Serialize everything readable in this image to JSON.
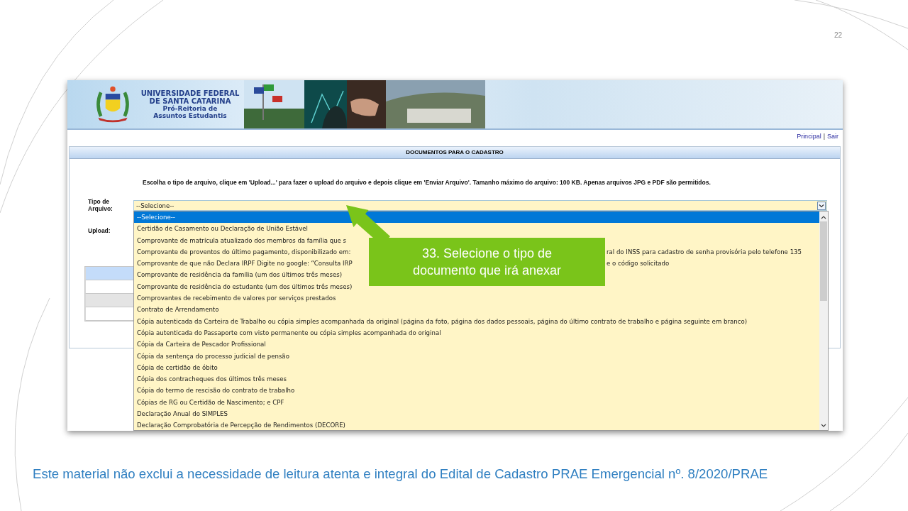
{
  "slide": {
    "page_number": "22",
    "footer": "Este material não exclui a necessidade de leitura atenta e integral do Edital de Cadastro PRAE Emergencial nº. 8/2020/PRAE"
  },
  "header": {
    "institution": [
      "UNIVERSIDADE FEDERAL",
      "DE SANTA CATARINA"
    ],
    "department": [
      "Pró-Reitoria de",
      "Assuntos Estudantis"
    ]
  },
  "nav_links": [
    {
      "label": "Principal"
    },
    {
      "label": "Sair"
    }
  ],
  "nav_separator": "|",
  "panel": {
    "title": "DOCUMENTOS PARA O CADASTRO",
    "instructions": "Escolha o tipo de arquivo, clique em 'Upload...' para fazer o upload do arquivo e depois clique em 'Enviar Arquivo'. Tamanho máximo do arquivo: 100 KB. Apenas arquivos JPG e PDF são permitidos.",
    "file_type_label": "Tipo de Arquivo:",
    "upload_label": "Upload:"
  },
  "file_type_select": {
    "value": "--Selecione--",
    "expanded": true,
    "options": [
      {
        "text": "--Selecione--",
        "selected": true
      },
      {
        "text": "Certidão de Casamento ou Declaração de União Estável",
        "selected": false
      },
      {
        "text": "Comprovante de matrícula atualizado dos membros da família que s",
        "selected": false
      },
      {
        "text": "Comprovante de proventos do último pagamento, disponibilizado em:",
        "text_after": "ral do INSS para cadastro de senha provisória pelo telefone 135",
        "selected": false
      },
      {
        "text": "Comprovante de que não Declara IRPF Digite no google: “Consulta IRP",
        "text_after": "e o código solicitado",
        "selected": false
      },
      {
        "text": "Comprovante de residência da família (um dos últimos três meses)",
        "selected": false
      },
      {
        "text": "Comprovante de residência do estudante (um dos últimos três meses)",
        "selected": false
      },
      {
        "text": "Comprovantes de recebimento de valores por serviços prestados",
        "selected": false
      },
      {
        "text": "Contrato de Arrendamento",
        "selected": false
      },
      {
        "text": "Cópia autenticada da Carteira de Trabalho ou cópia simples acompanhada da original (página da foto, página dos dados pessoais, página do último contrato de trabalho e página seguinte em branco)",
        "selected": false
      },
      {
        "text": "Cópia autenticada do Passaporte com visto permanente ou cópia simples acompanhada do original",
        "selected": false
      },
      {
        "text": "Cópia da Carteira de Pescador Profissional",
        "selected": false
      },
      {
        "text": "Cópia da sentença do processo judicial de pensão",
        "selected": false
      },
      {
        "text": "Cópia de certidão de óbito",
        "selected": false
      },
      {
        "text": "Cópia dos contracheques dos últimos três meses",
        "selected": false
      },
      {
        "text": "Cópia do termo de rescisão do contrato de trabalho",
        "selected": false
      },
      {
        "text": "Cópias de RG ou Certidão de Nascimento; e CPF",
        "selected": false
      },
      {
        "text": "Declaração Anual do SIMPLES",
        "selected": false
      },
      {
        "text": "Declaração Comprobatória de Percepção de Rendimentos (DECORE)",
        "selected": false
      }
    ]
  },
  "callout": {
    "lines": [
      "33. Selecione o tipo de",
      "documento que irá anexar"
    ]
  }
}
